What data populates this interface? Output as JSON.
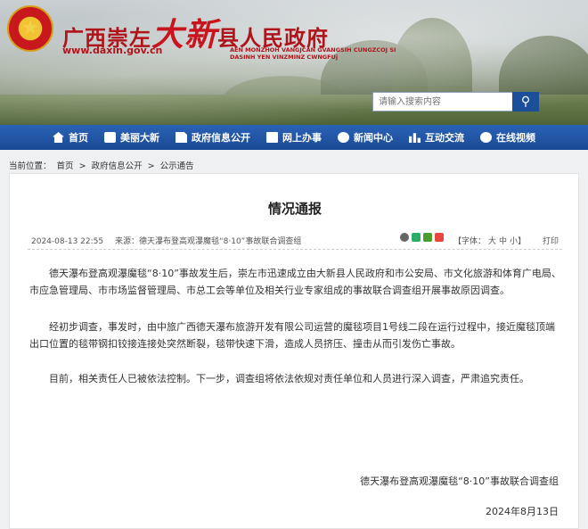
{
  "header": {
    "title_prefix": "广西崇左",
    "title_big": "大新",
    "title_suffix": "县人民政府",
    "url": "www.daxin.gov.cn",
    "pinyin_line1": "AEN MONZHOH VANGJCAN GVANGSIH CUNGZCOJ SI",
    "pinyin_line2": "DASINH YEN VINZMINZ CWNGFUj"
  },
  "search": {
    "placeholder": "请输入搜索内容",
    "button_icon": "search-icon"
  },
  "nav": {
    "items": [
      {
        "label": "首页",
        "icon": "home-icon"
      },
      {
        "label": "美丽大新",
        "icon": "photo-icon"
      },
      {
        "label": "政府信息公开",
        "icon": "document-icon"
      },
      {
        "label": "网上办事",
        "icon": "monitor-icon"
      },
      {
        "label": "新闻中心",
        "icon": "chat-icon"
      },
      {
        "label": "互动交流",
        "icon": "bar-chart-icon"
      },
      {
        "label": "在线视频",
        "icon": "video-icon"
      }
    ]
  },
  "breadcrumb": {
    "prefix": "当前位置：",
    "items": [
      "首页",
      "政府信息公开",
      "公示通告"
    ],
    "separator": ">"
  },
  "article": {
    "title": "情况通报",
    "date": "2024-08-13 22:55",
    "source": "来源：德天瀑布登高观瀑魔毯“8·10”事故联合调查组",
    "font_label": "【字体：",
    "font_options": [
      "大",
      "中",
      "小"
    ],
    "font_close": "】",
    "print": "打印",
    "paragraphs": [
      "德天瀑布登高观瀑魔毯“8·10”事故发生后，崇左市迅速成立由大新县人民政府和市公安局、市文化旅游和体育广电局、市应急管理局、市市场监督管理局、市总工会等单位及相关行业专家组成的事故联合调查组开展事故原因调查。",
      "经初步调查，事发时，由中旅广西德天瀑布旅游开发有限公司运营的魔毯项目1号线二段在运行过程中，接近魔毯顶端出口位置的毯带钢扣铰接连接处突然断裂，毯带快速下滑，造成人员挤压、撞击从而引发伤亡事故。",
      "目前，相关责任人已被依法控制。下一步，调查组将依法依规对责任单位和人员进行深入调查，严肃追究责任。"
    ],
    "signer": "德天瀑布登高观瀑魔毯“8·10”事故联合调查组",
    "sign_date": "2024年8月13日"
  },
  "colors": {
    "nav_bg": "#1a4a94",
    "title_red": "#b0141b",
    "search_btn": "#1c4e9a"
  }
}
